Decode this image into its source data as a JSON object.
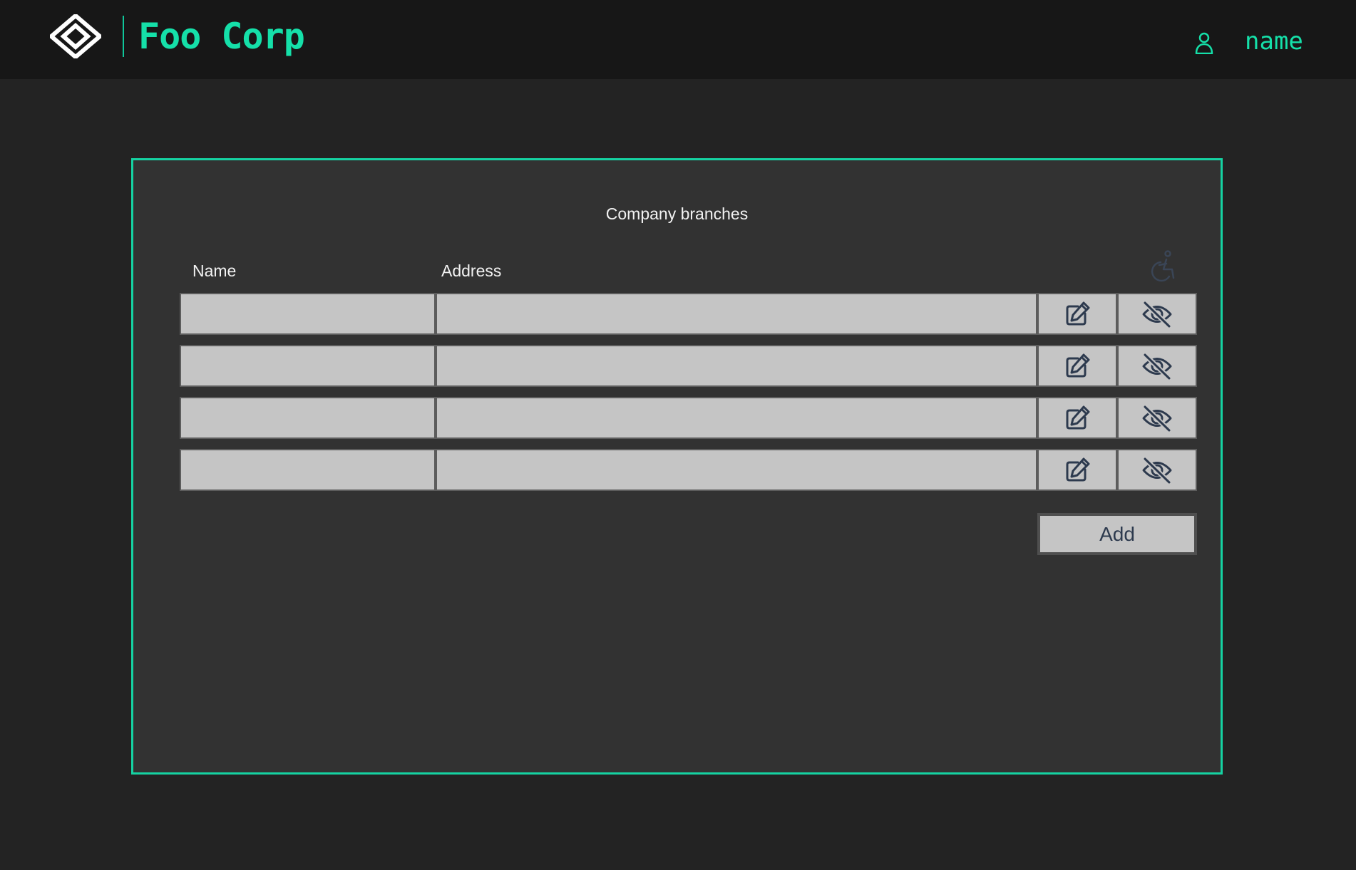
{
  "header": {
    "brand": "Foo Corp",
    "user_name": "name",
    "icons": {
      "logo": "diamond-logo-icon",
      "user": "user-icon"
    },
    "colors": {
      "accent": "#15e0a9",
      "background": "#171717"
    }
  },
  "panel": {
    "title": "Company branches",
    "columns": [
      "Name",
      "Address"
    ],
    "accessibility_icon": "wheelchair-icon",
    "rows": [
      {
        "name": "",
        "address": ""
      },
      {
        "name": "",
        "address": ""
      },
      {
        "name": "",
        "address": ""
      },
      {
        "name": "",
        "address": ""
      }
    ],
    "row_action_icons": [
      "edit-icon",
      "eye-off-icon"
    ],
    "add_label": "Add",
    "colors": {
      "border": "#15d2a2",
      "background": "#323232",
      "cell": "#c5c5c5",
      "icon": "#2d3a4e"
    }
  }
}
